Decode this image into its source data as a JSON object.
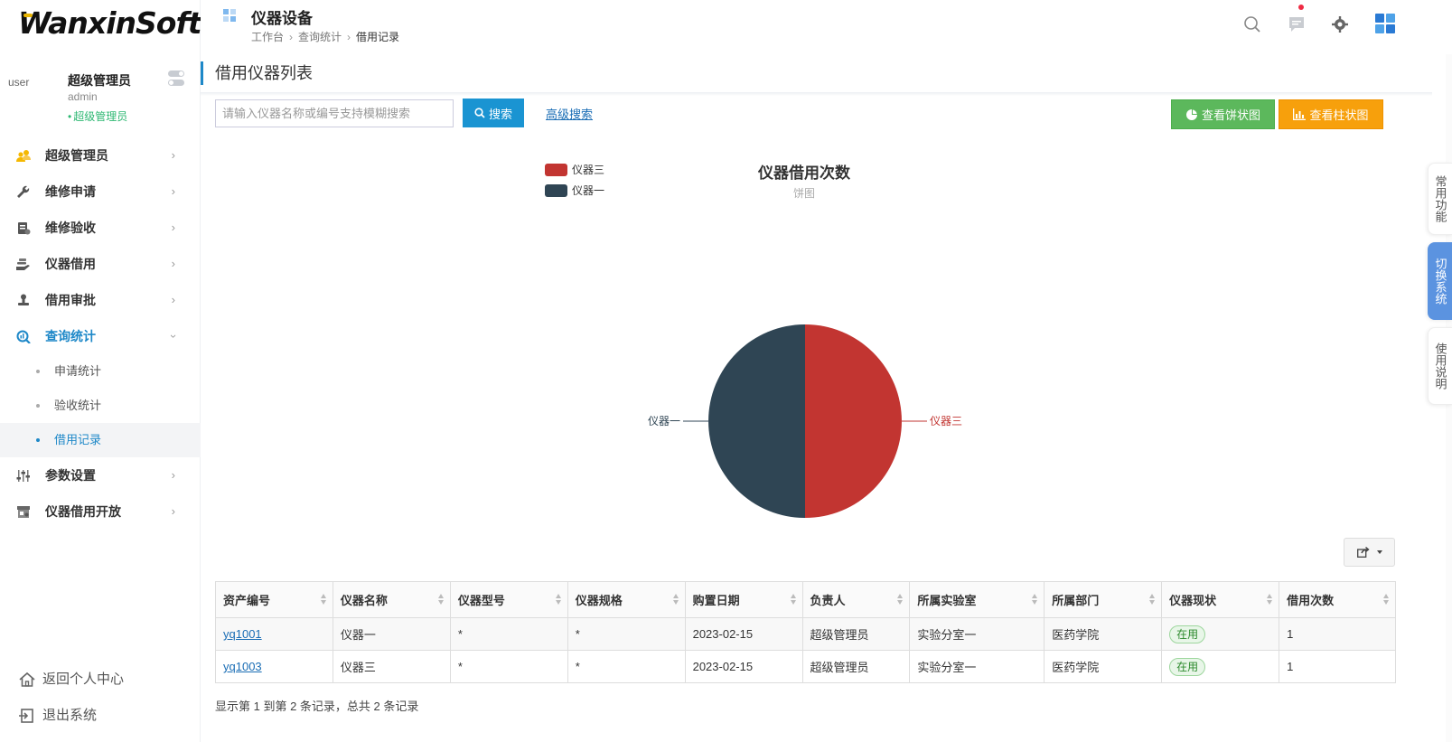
{
  "logo": {
    "text": "WanxinSoft"
  },
  "user": {
    "avatar_alt": "user",
    "name": "超级管理员",
    "login": "admin",
    "role": "超级管理员"
  },
  "menu": [
    {
      "label": "超级管理员",
      "icon": "users-icon"
    },
    {
      "label": "维修申请",
      "icon": "wrench-icon"
    },
    {
      "label": "维修验收",
      "icon": "clipboard-icon"
    },
    {
      "label": "仪器借用",
      "icon": "hand-icon"
    },
    {
      "label": "借用审批",
      "icon": "stamp-icon"
    },
    {
      "label": "查询统计",
      "icon": "chart-search-icon"
    },
    {
      "label": "参数设置",
      "icon": "sliders-icon"
    },
    {
      "label": "仪器借用开放",
      "icon": "store-icon"
    }
  ],
  "submenu": [
    {
      "label": "申请统计"
    },
    {
      "label": "验收统计"
    },
    {
      "label": "借用记录"
    }
  ],
  "bottom": {
    "home": "返回个人中心",
    "logout": "退出系统"
  },
  "header": {
    "title": "仪器设备",
    "breadcrumb": [
      "工作台",
      "查询统计",
      "借用记录"
    ]
  },
  "page": {
    "section_title": "借用仪器列表",
    "search_placeholder": "请输入仪器名称或编号支持模糊搜索",
    "search_button": "搜索",
    "advanced_search": "高级搜索",
    "pie_button": "查看饼状图",
    "bar_button": "查看柱状图"
  },
  "chart_data": {
    "type": "pie",
    "title": "仪器借用次数",
    "subtitle": "饼图",
    "legend_position": "top-left",
    "legend": [
      "仪器三",
      "仪器一"
    ],
    "slices": [
      {
        "label": "仪器三",
        "value": 1,
        "color": "#c23531"
      },
      {
        "label": "仪器一",
        "value": 1,
        "color": "#2f4554"
      }
    ]
  },
  "table": {
    "columns": [
      "资产编号",
      "仪器名称",
      "仪器型号",
      "仪器规格",
      "购置日期",
      "负责人",
      "所属实验室",
      "所属部门",
      "仪器现状",
      "借用次数"
    ],
    "rows": [
      [
        "yq1001",
        "仪器一",
        "*",
        "*",
        "2023-02-15",
        "超级管理员",
        "实验分室一",
        "医药学院",
        "在用",
        "1"
      ],
      [
        "yq1003",
        "仪器三",
        "*",
        "*",
        "2023-02-15",
        "超级管理员",
        "实验分室一",
        "医药学院",
        "在用",
        "1"
      ]
    ]
  },
  "pager_info": "显示第 1 到第 2 条记录，总共 2 条记录",
  "side_tabs": [
    "常用功能",
    "切换系统",
    "使用说明"
  ],
  "colors": {
    "accent": "#1e88c8",
    "search_button": "#1a94d2",
    "pie_button": "#5cb85c",
    "bar_button": "#f7a00c",
    "side_tab_active": "#5b93e0"
  }
}
